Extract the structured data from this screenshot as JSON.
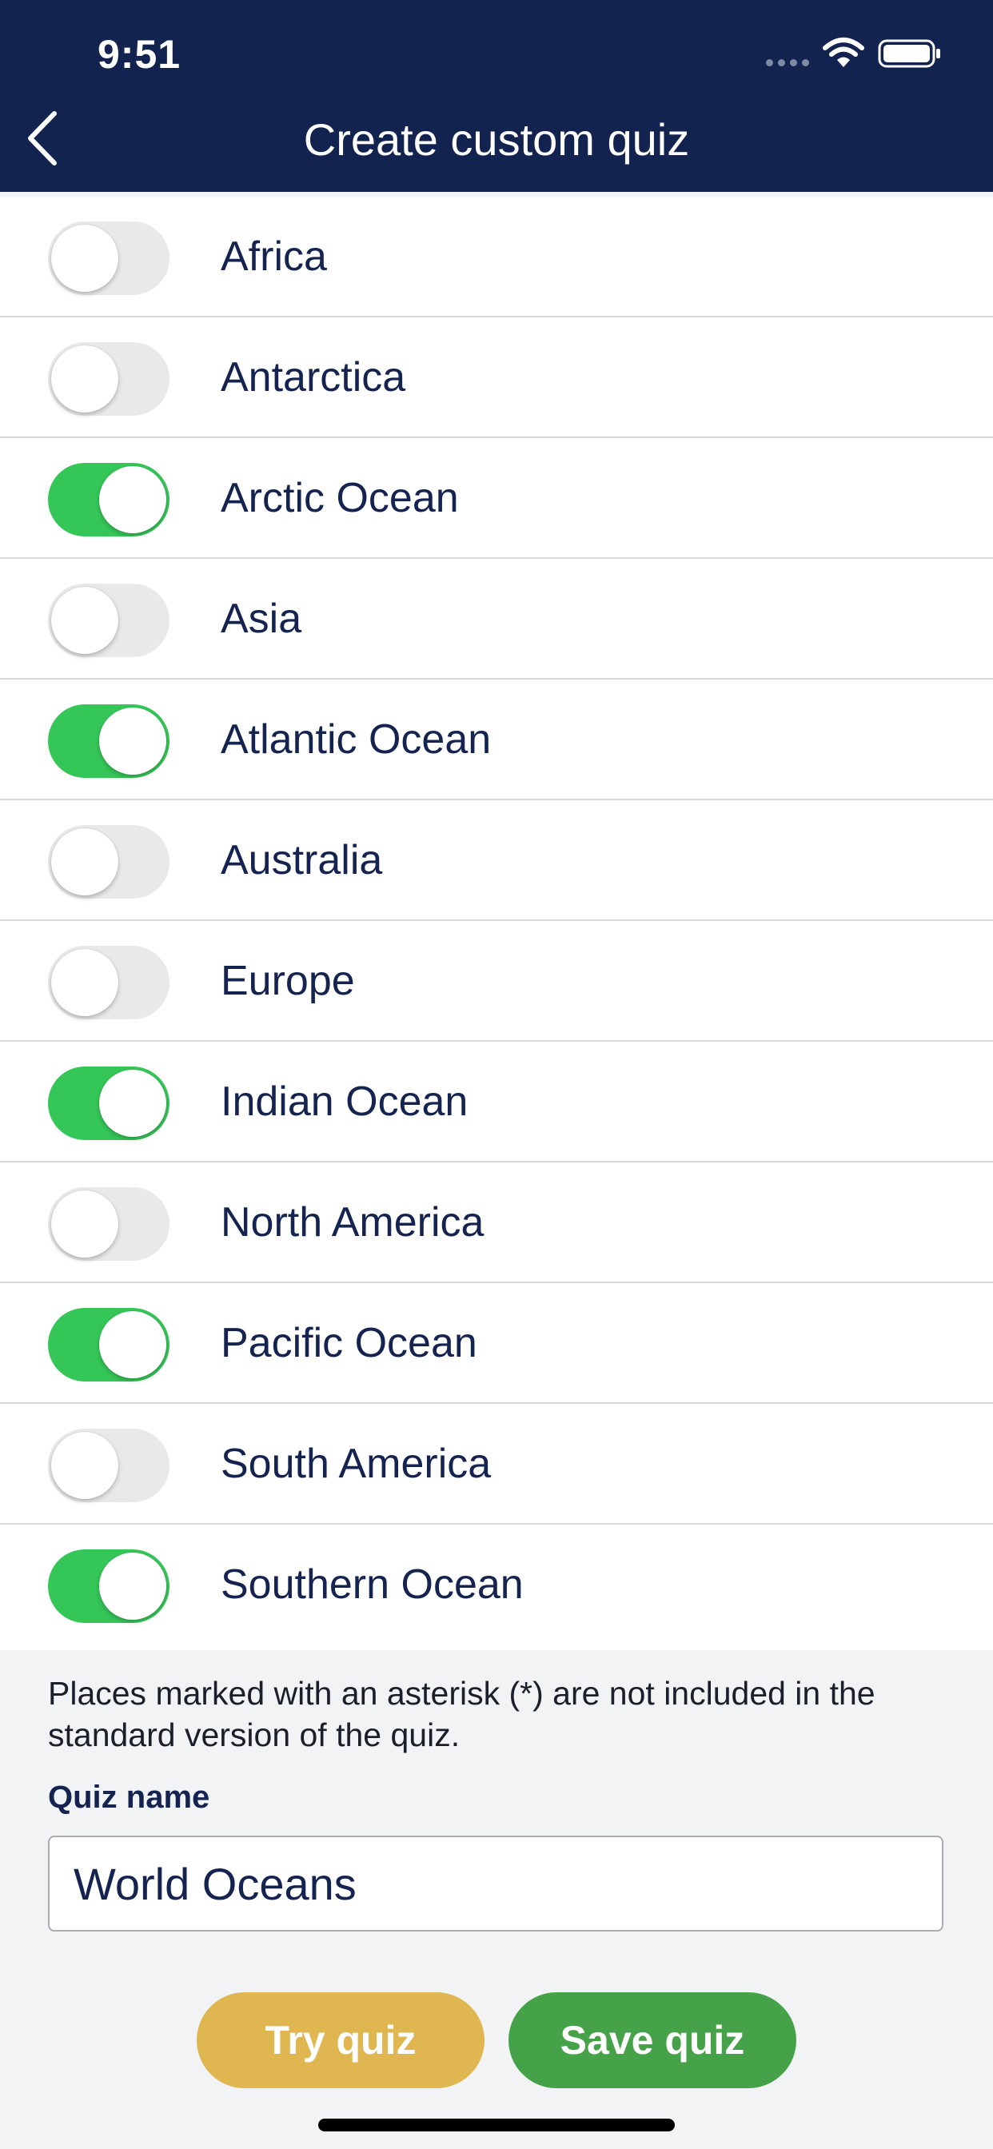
{
  "status_bar": {
    "time": "9:51"
  },
  "header": {
    "title": "Create custom quiz"
  },
  "items": [
    {
      "label": "Africa",
      "on": false
    },
    {
      "label": "Antarctica",
      "on": false
    },
    {
      "label": "Arctic Ocean",
      "on": true
    },
    {
      "label": "Asia",
      "on": false
    },
    {
      "label": "Atlantic Ocean",
      "on": true
    },
    {
      "label": "Australia",
      "on": false
    },
    {
      "label": "Europe",
      "on": false
    },
    {
      "label": "Indian Ocean",
      "on": true
    },
    {
      "label": "North America",
      "on": false
    },
    {
      "label": "Pacific Ocean",
      "on": true
    },
    {
      "label": "South America",
      "on": false
    },
    {
      "label": "Southern Ocean",
      "on": true
    }
  ],
  "footer": {
    "note": "Places marked with an asterisk (*) are not included in the standard version of the quiz.",
    "quiz_name_label": "Quiz name",
    "quiz_name_value": "World Oceans",
    "try_label": "Try quiz",
    "save_label": "Save quiz"
  },
  "colors": {
    "header_bg": "#13234f",
    "toggle_on": "#35c658",
    "toggle_off": "#e9e9ea",
    "try_button": "#dfb64f",
    "save_button": "#45a248"
  }
}
